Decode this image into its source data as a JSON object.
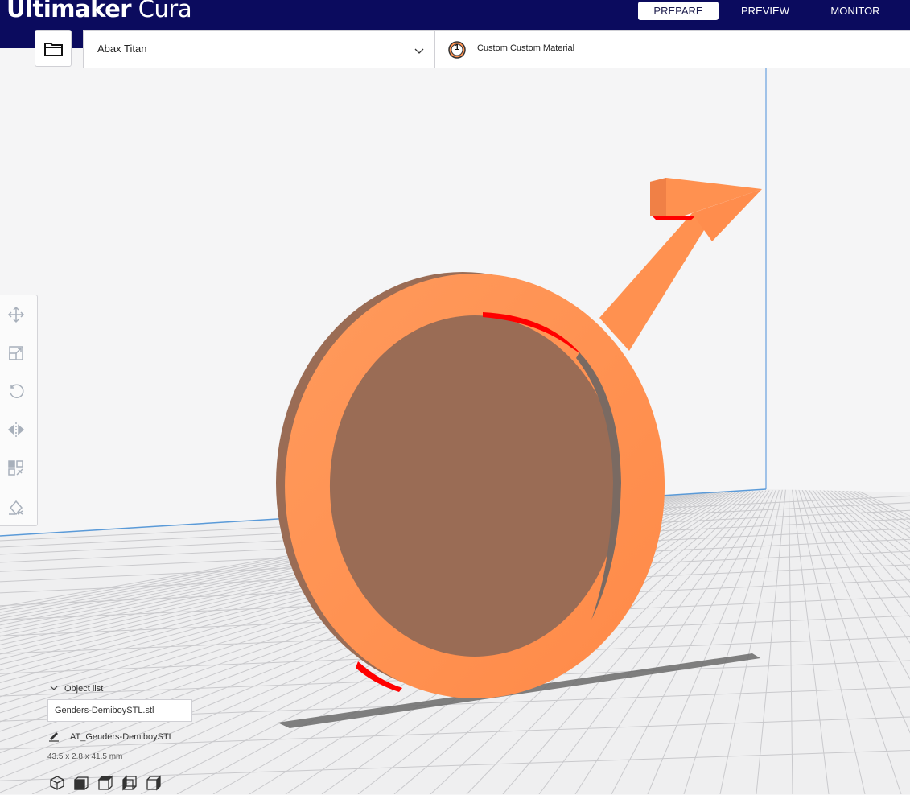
{
  "app": {
    "title_bold": "Ultimaker",
    "title_light": " Cura"
  },
  "stages": [
    {
      "label": "PREPARE",
      "active": true
    },
    {
      "label": "PREVIEW",
      "active": false
    },
    {
      "label": "MONITOR",
      "active": false
    }
  ],
  "toolbar": {
    "printer": "Abax Titan",
    "extruder_number": "1",
    "material": "Custom Custom Material",
    "open_icon": "folder-icon",
    "dropdown_icon": "chevron-down-icon"
  },
  "tools": [
    {
      "name": "move-tool",
      "icon": "move-icon"
    },
    {
      "name": "scale-tool",
      "icon": "scale-icon"
    },
    {
      "name": "rotate-tool",
      "icon": "rotate-icon"
    },
    {
      "name": "mirror-tool",
      "icon": "mirror-icon"
    },
    {
      "name": "per-model-settings-tool",
      "icon": "per-model-settings-icon"
    },
    {
      "name": "support-blocker-tool",
      "icon": "support-blocker-icon"
    }
  ],
  "object_list": {
    "header": "Object list",
    "file": "Genders-DemiboySTL.stl",
    "job_name": "AT_Genders-DemiboySTL",
    "dimensions": "43.5 x 2.8 x 41.5 mm"
  },
  "view_buttons": [
    "3d-view-icon",
    "front-view-icon",
    "top-view-icon",
    "left-view-icon",
    "right-view-icon"
  ],
  "colors": {
    "header_bg": "#0b0b5e",
    "model": "#ff9150",
    "model_shade": "#d9733c",
    "overhang": "#ff0000",
    "buildplate_lines": "#c9c9cc",
    "volume_edge": "#4a90d9"
  }
}
